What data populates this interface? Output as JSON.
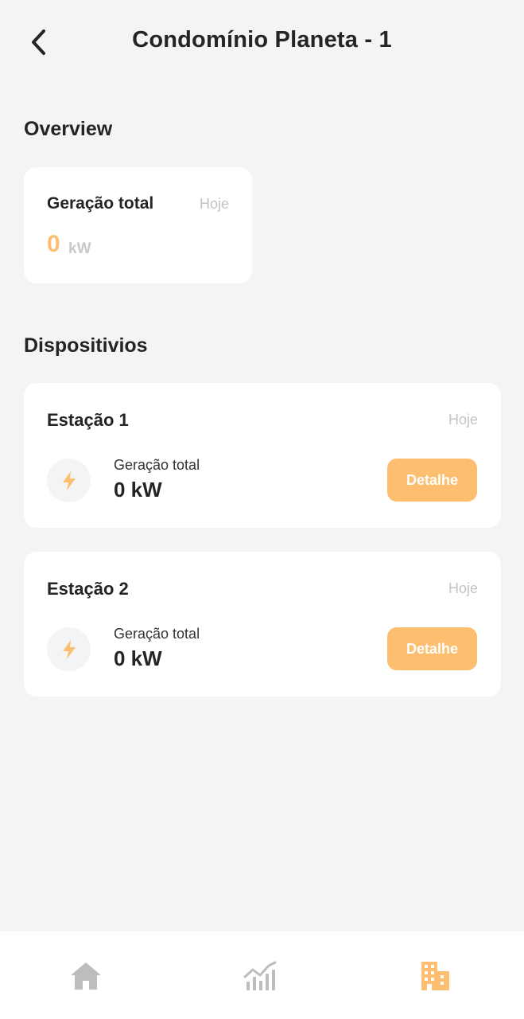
{
  "header": {
    "title": "Condomínio Planeta - 1",
    "back_icon": "chevron-left-icon"
  },
  "overview": {
    "section_title": "Overview",
    "card": {
      "label": "Geração total",
      "period": "Hoje",
      "value": "0",
      "unit": "kW"
    }
  },
  "devices": {
    "section_title": "Dispositivios",
    "items": [
      {
        "name": "Estação 1",
        "period": "Hoje",
        "icon": "lightning-bolt-icon",
        "generation_label": "Geração total",
        "generation_value": "0 kW",
        "detail_label": "Detalhe"
      },
      {
        "name": "Estação 2",
        "period": "Hoje",
        "icon": "lightning-bolt-icon",
        "generation_label": "Geração total",
        "generation_value": "0 kW",
        "detail_label": "Detalhe"
      }
    ]
  },
  "bottom_nav": {
    "items": [
      {
        "icon": "home-icon",
        "active": false
      },
      {
        "icon": "chart-icon",
        "active": false
      },
      {
        "icon": "building-icon",
        "active": true
      }
    ]
  },
  "colors": {
    "accent": "#fdbf6f",
    "background": "#f3f4f6",
    "card": "#ffffff",
    "inactive_icon": "#bdbdbd"
  }
}
